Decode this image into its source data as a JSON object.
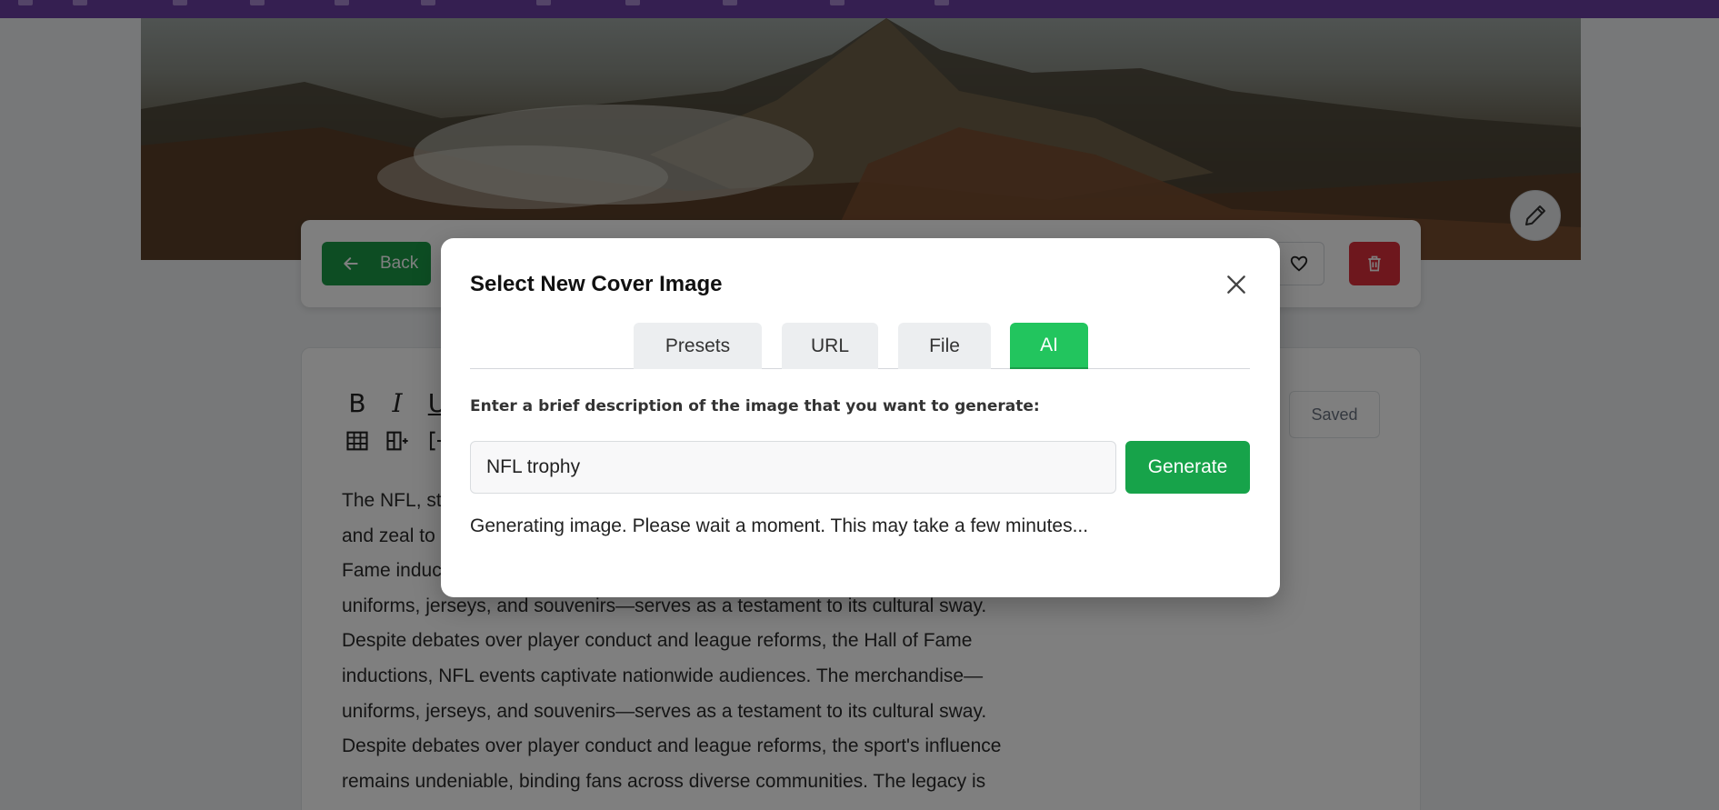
{
  "toolbar": {
    "back_label": "Back",
    "saved_label": "Saved"
  },
  "icons": {
    "back": "arrow-left-icon",
    "favorite": "heart-icon",
    "delete": "trash-icon",
    "edit_cover": "pencil-icon",
    "close": "close-icon"
  },
  "editor": {
    "format_row1": [
      "B",
      "I",
      "U"
    ],
    "format_row2": [
      "table",
      "column-insert",
      "bracket"
    ],
    "article_lines": [
      "The NFL, st",
      "and zeal to",
      "Fame induc",
      "uniforms, jerseys, and souvenirs—serves as a testament to its cultural sway.",
      "Despite debates over player conduct and league reforms, the Hall of Fame",
      "inductions, NFL events captivate nationwide audiences. The merchandise—",
      "uniforms, jerseys, and souvenirs—serves as a testament to its cultural sway.",
      "Despite debates over player conduct and league reforms, the sport's influence",
      "remains undeniable, binding fans across diverse communities. The legacy is"
    ]
  },
  "modal": {
    "title": "Select New Cover Image",
    "tabs": [
      {
        "label": "Presets",
        "active": false
      },
      {
        "label": "URL",
        "active": false
      },
      {
        "label": "File",
        "active": false
      },
      {
        "label": "AI",
        "active": true
      }
    ],
    "prompt_label": "Enter a brief description of the image that you want to generate:",
    "input_value": "NFL trophy",
    "generate_label": "Generate",
    "status": "Generating image. Please wait a moment. This may take a few minutes..."
  },
  "colors": {
    "topbar": "#6b3fa3",
    "primary_green": "#17a34a",
    "active_tab": "#22c55e",
    "danger": "#dc2f3b"
  }
}
